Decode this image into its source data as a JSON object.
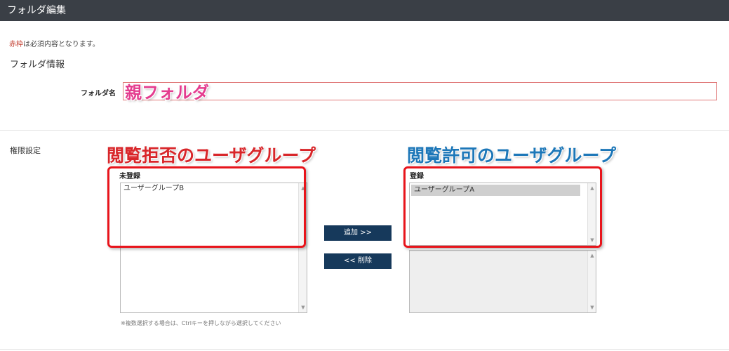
{
  "header": {
    "title": "フォルダ編集"
  },
  "note": {
    "red_part": "赤枠",
    "rest": "は必須内容となります。"
  },
  "folder_info": {
    "section_title": "フォルダ情報",
    "name_label": "フォルダ名",
    "name_value": "親フォルダ",
    "overlay_text": "親フォルダ"
  },
  "permissions": {
    "label": "権限設定",
    "deny_annotation": "閲覧拒否のユーザグループ",
    "allow_annotation": "閲覧許可のユーザグループ",
    "unregistered": {
      "header": "未登録",
      "items": [
        "ユーザーグループB"
      ]
    },
    "registered": {
      "header": "登録",
      "items": [
        "ユーザーグループA"
      ]
    },
    "add_button": "追加 >>",
    "remove_button": "<< 削除",
    "hint": "※複数選択する場合は、Ctrlキーを押しながら選択してください"
  },
  "colors": {
    "titlebar": "#3a3f46",
    "button": "#16395b",
    "required_border": "#e07a7a",
    "annotation_red": "#e8141b",
    "annotation_blue": "#1d77b8",
    "annotation_pink": "#e43d8f"
  }
}
